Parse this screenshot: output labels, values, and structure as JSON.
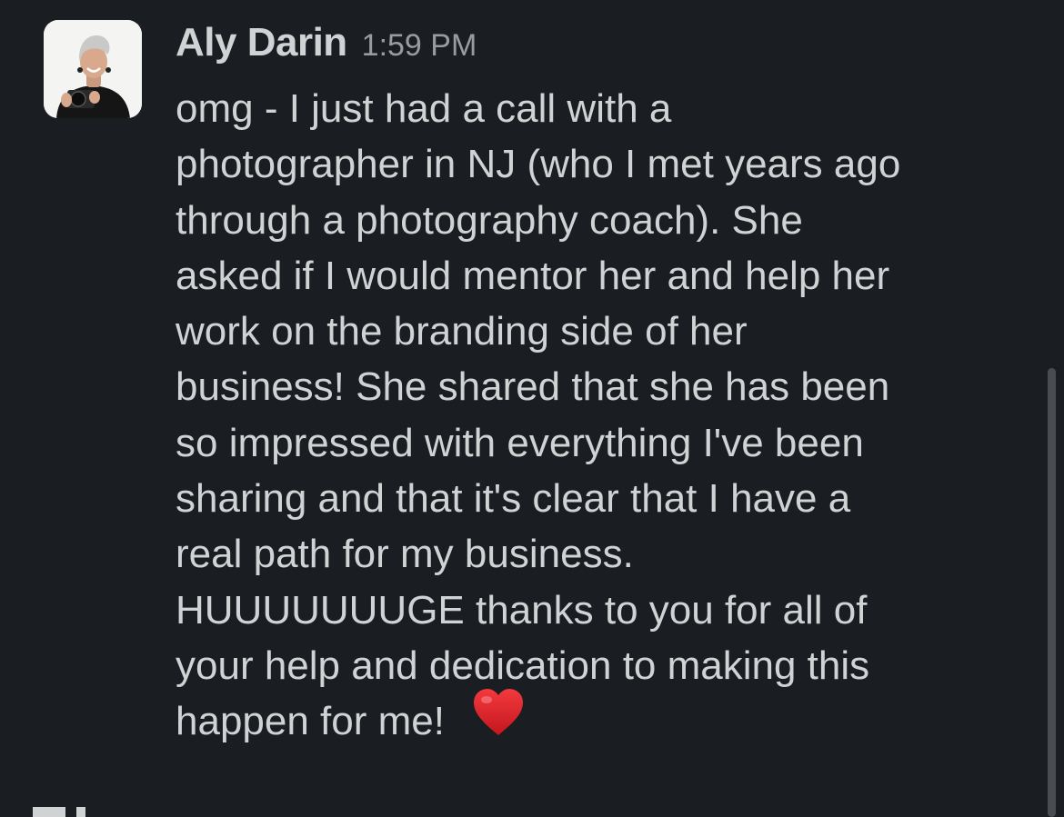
{
  "message": {
    "sender": "Aly Darin",
    "time": "1:59 PM",
    "lines": [
      "omg - I just had a call with a",
      "photographer in NJ (who I met years ago",
      "through a photography coach).  She",
      "asked if I would mentor her and help her",
      "work on the branding side of her",
      "business!  She shared that she has been",
      "so impressed with everything I've been",
      "sharing and that it's clear that I have a",
      "real path for my business.",
      "HUUUUUUUGE thanks to you for all of",
      "your help and dedication to making this",
      "happen for me!"
    ],
    "emoji": "red-heart-icon"
  },
  "colors": {
    "background": "#1a1d21",
    "text": "#d1d2d3",
    "timestamp": "#9a9b9d",
    "heart": "#e0242d"
  }
}
